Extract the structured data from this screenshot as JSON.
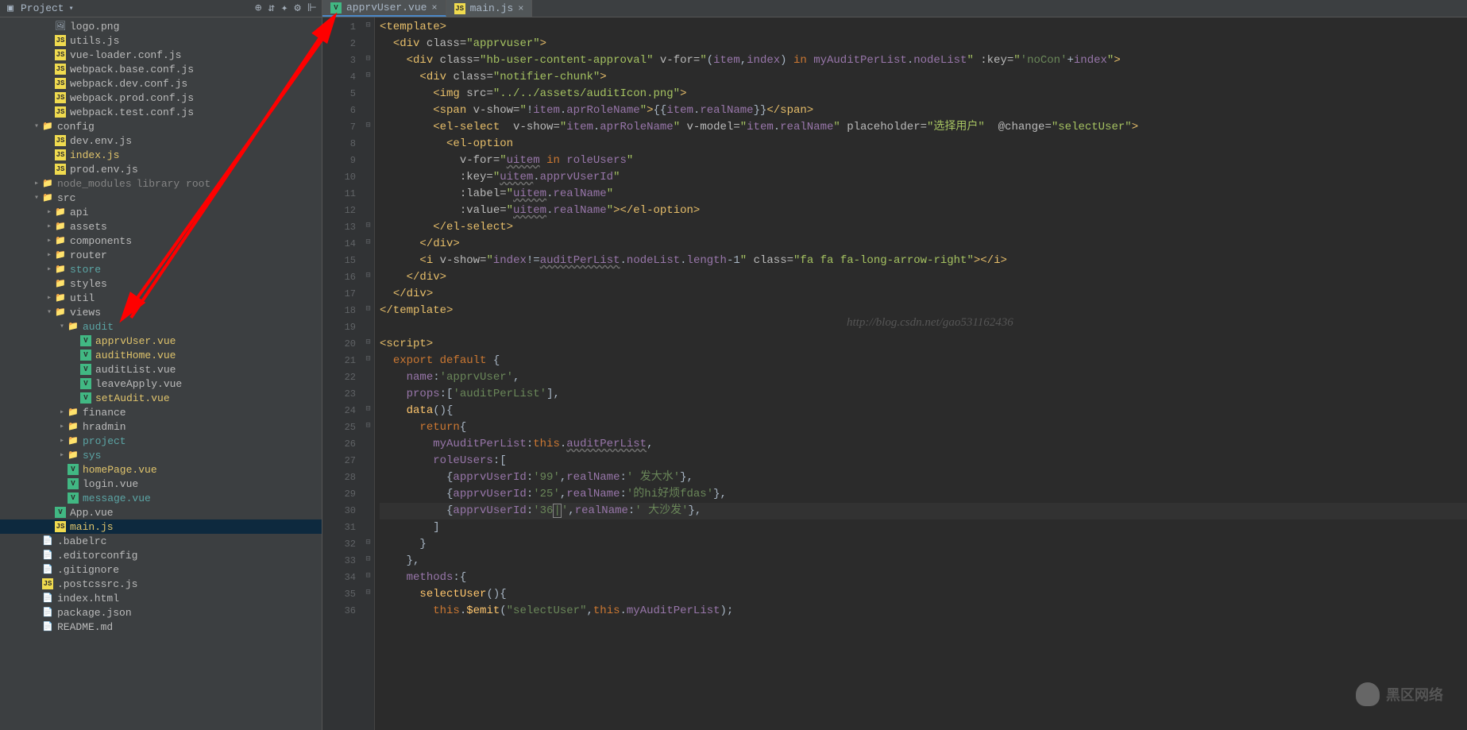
{
  "sidebar": {
    "title": "Project",
    "toolbar": [
      "⊕",
      "⇵",
      "✦",
      "⚙",
      "⊩"
    ],
    "tree": [
      {
        "depth": 3,
        "arrow": "",
        "icon": "img",
        "label": "logo.png",
        "cls": ""
      },
      {
        "depth": 3,
        "arrow": "",
        "icon": "js",
        "label": "utils.js",
        "cls": ""
      },
      {
        "depth": 3,
        "arrow": "",
        "icon": "js",
        "label": "vue-loader.conf.js",
        "cls": ""
      },
      {
        "depth": 3,
        "arrow": "",
        "icon": "js",
        "label": "webpack.base.conf.js",
        "cls": ""
      },
      {
        "depth": 3,
        "arrow": "",
        "icon": "js",
        "label": "webpack.dev.conf.js",
        "cls": ""
      },
      {
        "depth": 3,
        "arrow": "",
        "icon": "js",
        "label": "webpack.prod.conf.js",
        "cls": ""
      },
      {
        "depth": 3,
        "arrow": "",
        "icon": "js",
        "label": "webpack.test.conf.js",
        "cls": ""
      },
      {
        "depth": 2,
        "arrow": "▾",
        "icon": "folder",
        "label": "config",
        "cls": ""
      },
      {
        "depth": 3,
        "arrow": "",
        "icon": "js",
        "label": "dev.env.js",
        "cls": ""
      },
      {
        "depth": 3,
        "arrow": "",
        "icon": "js",
        "label": "index.js",
        "cls": "highlight"
      },
      {
        "depth": 3,
        "arrow": "",
        "icon": "js",
        "label": "prod.env.js",
        "cls": ""
      },
      {
        "depth": 2,
        "arrow": "▸",
        "icon": "folder",
        "label": "node_modules",
        "cls": "dim",
        "extra": "library root"
      },
      {
        "depth": 2,
        "arrow": "▾",
        "icon": "folder",
        "label": "src",
        "cls": ""
      },
      {
        "depth": 3,
        "arrow": "▸",
        "icon": "folder",
        "label": "api",
        "cls": ""
      },
      {
        "depth": 3,
        "arrow": "▸",
        "icon": "folder",
        "label": "assets",
        "cls": ""
      },
      {
        "depth": 3,
        "arrow": "▸",
        "icon": "folder",
        "label": "components",
        "cls": ""
      },
      {
        "depth": 3,
        "arrow": "▸",
        "icon": "folder",
        "label": "router",
        "cls": ""
      },
      {
        "depth": 3,
        "arrow": "▸",
        "icon": "folder",
        "label": "store",
        "cls": "teal"
      },
      {
        "depth": 3,
        "arrow": "",
        "icon": "folder",
        "label": "styles",
        "cls": ""
      },
      {
        "depth": 3,
        "arrow": "▸",
        "icon": "folder",
        "label": "util",
        "cls": ""
      },
      {
        "depth": 3,
        "arrow": "▾",
        "icon": "folder",
        "label": "views",
        "cls": ""
      },
      {
        "depth": 4,
        "arrow": "▾",
        "icon": "folder",
        "label": "audit",
        "cls": "teal"
      },
      {
        "depth": 5,
        "arrow": "",
        "icon": "vue",
        "label": "apprvUser.vue",
        "cls": "highlight"
      },
      {
        "depth": 5,
        "arrow": "",
        "icon": "vue",
        "label": "auditHome.vue",
        "cls": "highlight"
      },
      {
        "depth": 5,
        "arrow": "",
        "icon": "vue",
        "label": "auditList.vue",
        "cls": ""
      },
      {
        "depth": 5,
        "arrow": "",
        "icon": "vue",
        "label": "leaveApply.vue",
        "cls": ""
      },
      {
        "depth": 5,
        "arrow": "",
        "icon": "vue",
        "label": "setAudit.vue",
        "cls": "highlight"
      },
      {
        "depth": 4,
        "arrow": "▸",
        "icon": "folder",
        "label": "finance",
        "cls": ""
      },
      {
        "depth": 4,
        "arrow": "▸",
        "icon": "folder",
        "label": "hradmin",
        "cls": ""
      },
      {
        "depth": 4,
        "arrow": "▸",
        "icon": "folder",
        "label": "project",
        "cls": "teal"
      },
      {
        "depth": 4,
        "arrow": "▸",
        "icon": "folder",
        "label": "sys",
        "cls": "teal"
      },
      {
        "depth": 4,
        "arrow": "",
        "icon": "vue",
        "label": "homePage.vue",
        "cls": "highlight"
      },
      {
        "depth": 4,
        "arrow": "",
        "icon": "vue",
        "label": "login.vue",
        "cls": ""
      },
      {
        "depth": 4,
        "arrow": "",
        "icon": "vue",
        "label": "message.vue",
        "cls": "teal"
      },
      {
        "depth": 3,
        "arrow": "",
        "icon": "vue",
        "label": "App.vue",
        "cls": ""
      },
      {
        "depth": 3,
        "arrow": "",
        "icon": "js",
        "label": "main.js",
        "cls": "highlight",
        "selected": true
      },
      {
        "depth": 2,
        "arrow": "",
        "icon": "file",
        "label": ".babelrc",
        "cls": ""
      },
      {
        "depth": 2,
        "arrow": "",
        "icon": "file",
        "label": ".editorconfig",
        "cls": ""
      },
      {
        "depth": 2,
        "arrow": "",
        "icon": "file",
        "label": ".gitignore",
        "cls": ""
      },
      {
        "depth": 2,
        "arrow": "",
        "icon": "js",
        "label": ".postcssrc.js",
        "cls": ""
      },
      {
        "depth": 2,
        "arrow": "",
        "icon": "file",
        "label": "index.html",
        "cls": ""
      },
      {
        "depth": 2,
        "arrow": "",
        "icon": "file",
        "label": "package.json",
        "cls": ""
      },
      {
        "depth": 2,
        "arrow": "",
        "icon": "file",
        "label": "README.md",
        "cls": ""
      }
    ]
  },
  "tabs": [
    {
      "label": "apprvUser.vue",
      "active": true,
      "icon": "vue"
    },
    {
      "label": "main.js",
      "active": false,
      "icon": "js"
    }
  ],
  "watermark_url": "http://blog.csdn.net/gao531162436",
  "logo_text": "黑区网络",
  "logo_sub": "",
  "code_lines": [
    {
      "n": 1,
      "fold": "⊟",
      "html": "<span class='c-tag'>&lt;template&gt;</span>"
    },
    {
      "n": 2,
      "fold": "",
      "html": "  <span class='c-tag'>&lt;div </span><span class='c-attr'>class=</span><span class='c-str'>\"apprvuser\"</span><span class='c-tag'>&gt;</span>"
    },
    {
      "n": 3,
      "fold": "⊟",
      "html": "    <span class='c-tag'>&lt;div </span><span class='c-attr'>class=</span><span class='c-str'>\"hb-user-content-approval\"</span> <span class='c-attr'>v-for=</span><span class='c-str'>\"</span><span class='c-op'>(</span><span class='c-var'>item</span><span class='c-op'>,</span><span class='c-var'>index</span><span class='c-op'>) </span><span class='c-kw'>in </span><span class='c-var'>myAuditPerList</span><span class='c-op'>.</span><span class='c-var'>nodeList</span><span class='c-str'>\"</span> <span class='c-attr'>:key=</span><span class='c-str'>\"</span><span class='c-js-str'>'noCon'</span><span class='c-op'>+</span><span class='c-var'>index</span><span class='c-str'>\"</span><span class='c-tag'>&gt;</span>"
    },
    {
      "n": 4,
      "fold": "⊟",
      "html": "      <span class='c-tag'>&lt;div </span><span class='c-attr'>class=</span><span class='c-str'>\"notifier-chunk\"</span><span class='c-tag'>&gt;</span>"
    },
    {
      "n": 5,
      "fold": "",
      "html": "        <span class='c-tag'>&lt;img </span><span class='c-attr'>src=</span><span class='c-str'>\"../../assets/auditIcon.png\"</span><span class='c-tag'>&gt;</span>"
    },
    {
      "n": 6,
      "fold": "",
      "html": "        <span class='c-tag'>&lt;span </span><span class='c-attr'>v-show=</span><span class='c-str'>\"</span><span class='c-op'>!</span><span class='c-var'>item</span><span class='c-op'>.</span><span class='c-var'>aprRoleName</span><span class='c-str'>\"</span><span class='c-tag'>&gt;</span><span class='c-op'>{{</span><span class='c-var'>item</span><span class='c-op'>.</span><span class='c-var'>realName</span><span class='c-op'>}}</span><span class='c-tag'>&lt;/span&gt;</span>"
    },
    {
      "n": 7,
      "fold": "⊟",
      "html": "        <span class='c-tag'>&lt;el-select  </span><span class='c-attr'>v-show=</span><span class='c-str'>\"</span><span class='c-var'>item</span><span class='c-op'>.</span><span class='c-var'>aprRoleName</span><span class='c-str'>\"</span> <span class='c-attr'>v-model=</span><span class='c-str'>\"</span><span class='c-var'>item</span><span class='c-op'>.</span><span class='c-var'>realName</span><span class='c-str'>\"</span> <span class='c-attr'>placeholder=</span><span class='c-str'>\"选择用户\"</span>  <span class='c-attr'>@change=</span><span class='c-str'>\"selectUser\"</span><span class='c-tag'>&gt;</span>"
    },
    {
      "n": 8,
      "fold": "",
      "html": "          <span class='c-tag'>&lt;el-option</span>"
    },
    {
      "n": 9,
      "fold": "",
      "html": "            <span class='c-attr'>v-for=</span><span class='c-str'>\"</span><span class='c-var underline'>uitem</span> <span class='c-kw'>in </span><span class='c-var'>roleUsers</span><span class='c-str'>\"</span>"
    },
    {
      "n": 10,
      "fold": "",
      "html": "            <span class='c-attr'>:key=</span><span class='c-str'>\"</span><span class='c-var underline'>uitem</span><span class='c-op'>.</span><span class='c-var'>apprvUserId</span><span class='c-str'>\"</span>"
    },
    {
      "n": 11,
      "fold": "",
      "html": "            <span class='c-attr'>:label=</span><span class='c-str'>\"</span><span class='c-var underline'>uitem</span><span class='c-op'>.</span><span class='c-var'>realName</span><span class='c-str'>\"</span>"
    },
    {
      "n": 12,
      "fold": "",
      "html": "            <span class='c-attr'>:value=</span><span class='c-str'>\"</span><span class='c-var underline'>uitem</span><span class='c-op'>.</span><span class='c-var'>realName</span><span class='c-str'>\"</span><span class='c-tag'>&gt;&lt;/el-option&gt;</span>"
    },
    {
      "n": 13,
      "fold": "⊟",
      "html": "        <span class='c-tag'>&lt;/el-select&gt;</span>"
    },
    {
      "n": 14,
      "fold": "⊟",
      "html": "      <span class='c-tag'>&lt;/div&gt;</span>"
    },
    {
      "n": 15,
      "fold": "",
      "html": "      <span class='c-tag'>&lt;i </span><span class='c-attr'>v-show=</span><span class='c-str'>\"</span><span class='c-var'>index</span><span class='c-op'>!=</span><span class='c-var underline'>auditPerList</span><span class='c-op'>.</span><span class='c-var'>nodeList</span><span class='c-op'>.</span><span class='c-var'>length</span><span class='c-op'>-1</span><span class='c-str'>\"</span> <span class='c-attr'>class=</span><span class='c-str'>\"fa fa fa-long-arrow-right\"</span><span class='c-tag'>&gt;&lt;/i&gt;</span>"
    },
    {
      "n": 16,
      "fold": "⊟",
      "html": "    <span class='c-tag'>&lt;/div&gt;</span>"
    },
    {
      "n": 17,
      "fold": "",
      "html": "  <span class='c-tag'>&lt;/div&gt;</span>"
    },
    {
      "n": 18,
      "fold": "⊟",
      "html": "<span class='c-tag'>&lt;/template&gt;</span>"
    },
    {
      "n": 19,
      "fold": "",
      "html": ""
    },
    {
      "n": 20,
      "fold": "⊟",
      "html": "<span class='c-tag'>&lt;script&gt;</span>"
    },
    {
      "n": 21,
      "fold": "⊟",
      "html": "  <span class='c-kw'>export default </span><span class='c-op'>{</span>"
    },
    {
      "n": 22,
      "fold": "",
      "html": "    <span class='c-var'>name</span><span class='c-op'>:</span><span class='c-js-str'>'apprvUser'</span><span class='c-op'>,</span>"
    },
    {
      "n": 23,
      "fold": "",
      "html": "    <span class='c-var'>props</span><span class='c-op'>:[</span><span class='c-js-str'>'auditPerList'</span><span class='c-op'>],</span>"
    },
    {
      "n": 24,
      "fold": "⊟",
      "html": "    <span class='c-fn'>data</span><span class='c-op'>(){</span>"
    },
    {
      "n": 25,
      "fold": "⊟",
      "html": "      <span class='c-kw'>return</span><span class='c-op'>{</span>"
    },
    {
      "n": 26,
      "fold": "",
      "html": "        <span class='c-var'>myAuditPerList</span><span class='c-op'>:</span><span class='c-this'>this</span><span class='c-op'>.</span><span class='c-var underline'>auditPerList</span><span class='c-op'>,</span>"
    },
    {
      "n": 27,
      "fold": "",
      "html": "        <span class='c-var'>roleUsers</span><span class='c-op'>:[</span>"
    },
    {
      "n": 28,
      "fold": "",
      "html": "          <span class='c-op'>{</span><span class='c-var'>apprvUserId</span><span class='c-op'>:</span><span class='c-js-str'>'99'</span><span class='c-op'>,</span><span class='c-var'>realName</span><span class='c-op'>:</span><span class='c-js-str'>' 发大水'</span><span class='c-op'>},</span>"
    },
    {
      "n": 29,
      "fold": "",
      "html": "          <span class='c-op'>{</span><span class='c-var'>apprvUserId</span><span class='c-op'>:</span><span class='c-js-str'>'25'</span><span class='c-op'>,</span><span class='c-var'>realName</span><span class='c-op'>:</span><span class='c-js-str'>'的hi好烦fdas'</span><span class='c-op'>},</span>"
    },
    {
      "n": 30,
      "fold": "",
      "html": "          <span class='c-op'>{</span><span class='c-var'>apprvUserId</span><span class='c-op'>:</span><span class='c-js-str'>'36<span style='border:1px solid #888;'>|</span>'</span><span class='c-op'>,</span><span class='c-var'>realName</span><span class='c-op'>:</span><span class='c-js-str'>' 大沙发'</span><span class='c-op'>},</span>",
      "current": true
    },
    {
      "n": 31,
      "fold": "",
      "html": "        <span class='c-op'>]</span>"
    },
    {
      "n": 32,
      "fold": "⊟",
      "html": "      <span class='c-op'>}</span>"
    },
    {
      "n": 33,
      "fold": "⊟",
      "html": "    <span class='c-op'>},</span>"
    },
    {
      "n": 34,
      "fold": "⊟",
      "html": "    <span class='c-var'>methods</span><span class='c-op'>:{</span>"
    },
    {
      "n": 35,
      "fold": "⊟",
      "html": "      <span class='c-fn'>selectUser</span><span class='c-op'>(){</span>"
    },
    {
      "n": 36,
      "fold": "",
      "html": "        <span class='c-this'>this</span><span class='c-op'>.</span><span class='c-fn'>$emit</span><span class='c-op'>(</span><span class='c-js-str'>\"selectUser\"</span><span class='c-op'>,</span><span class='c-this'>this</span><span class='c-op'>.</span><span class='c-var'>myAuditPerList</span><span class='c-op'>);</span>"
    }
  ]
}
